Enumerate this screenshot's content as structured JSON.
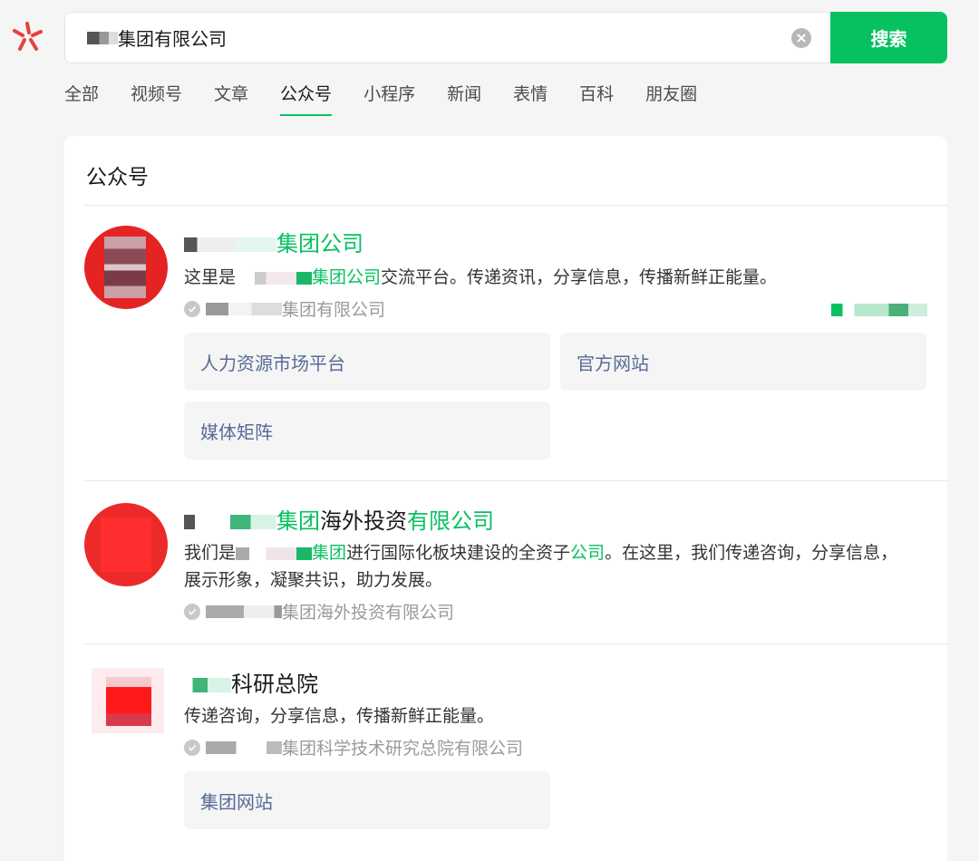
{
  "search": {
    "query": "集团有限公司",
    "button_label": "搜索"
  },
  "tabs": [
    {
      "label": "全部"
    },
    {
      "label": "视频号"
    },
    {
      "label": "文章"
    },
    {
      "label": "公众号",
      "active": true
    },
    {
      "label": "小程序"
    },
    {
      "label": "新闻"
    },
    {
      "label": "表情"
    },
    {
      "label": "百科"
    },
    {
      "label": "朋友圈"
    }
  ],
  "section_title": "公众号",
  "results": [
    {
      "name_hl": "集团公司",
      "desc_pre": "这里是",
      "desc_hl": "集团公司",
      "desc_post": "交流平台。传递资讯，分享信息，传播新鲜正能量。",
      "source": "集团有限公司",
      "menus": [
        "人力资源市场平台",
        "官方网站",
        "媒体矩阵"
      ]
    },
    {
      "name_hl1": "集团",
      "name_plain": "海外投资",
      "name_hl2": "有限公司",
      "desc_pre": "我们是",
      "desc_hl1": "集团",
      "desc_mid": "进行国际化板块建设的全资子",
      "desc_hl2": "公司",
      "desc_post": "。在这里，我们传递咨询，分享信息，展示形象，凝聚共识，助力发展。",
      "source": "集团海外投资有限公司"
    },
    {
      "name_plain": "科研总院",
      "desc": "传递咨询，分享信息，传播新鲜正能量。",
      "source": "集团科学技术研究总院有限公司",
      "menus": [
        "集团网站"
      ]
    }
  ],
  "colors": {
    "accent": "#07c160",
    "link": "#576b95"
  }
}
